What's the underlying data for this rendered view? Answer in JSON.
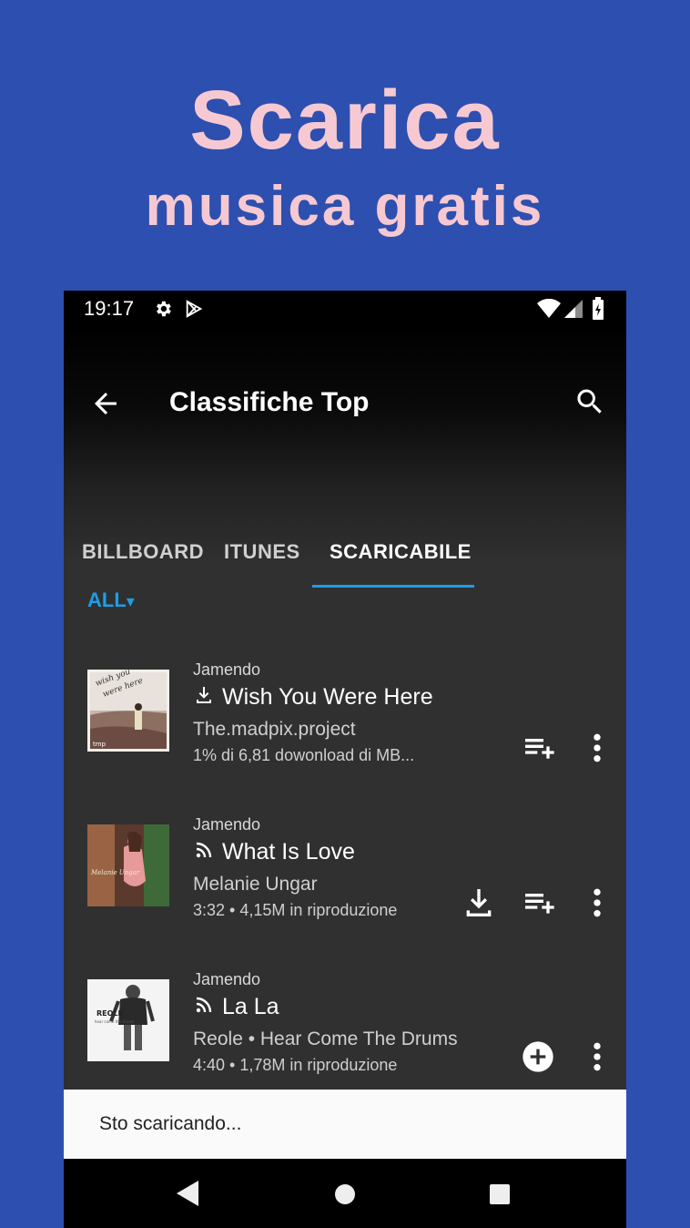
{
  "promo": {
    "title": "Scarica",
    "subtitle": "musica gratis"
  },
  "status_bar": {
    "time": "19:17",
    "icons": [
      "settings-icon",
      "play-store-icon",
      "wifi-icon",
      "cellular-signal-icon",
      "battery-charging-icon"
    ]
  },
  "app_bar": {
    "title": "Classifiche Top",
    "back_icon": "arrow-back-icon",
    "search_icon": "search-icon"
  },
  "tabs": [
    {
      "label": "BILLBOARD",
      "active": false
    },
    {
      "label": "ITUNES",
      "active": false
    },
    {
      "label": "SCARICABILE",
      "active": true
    }
  ],
  "filter": {
    "label": "ALL",
    "arrow": "▾"
  },
  "tracks": [
    {
      "source": "Jamendo",
      "title": "Wish You Were Here",
      "status_icon": "download-icon",
      "artist": "The.madpix.project",
      "meta": "1% di 6,81 dowonload di MB...",
      "actions": [
        "add-to-queue-icon",
        "more-vert-icon"
      ]
    },
    {
      "source": "Jamendo",
      "title": "What Is Love",
      "status_icon": "streaming-icon",
      "artist": "Melanie Ungar",
      "meta": "3:32 • 4,15M in riproduzione",
      "actions": [
        "download-icon",
        "add-to-queue-icon",
        "more-vert-icon"
      ]
    },
    {
      "source": "Jamendo",
      "title": "La La",
      "status_icon": "streaming-icon",
      "artist": "Reole • Hear Come The Drums",
      "meta": "4:40 • 1,78M in riproduzione",
      "actions": [
        "add-circle-icon",
        "more-vert-icon"
      ]
    }
  ],
  "snackbar": {
    "text": "Sto scaricando..."
  },
  "nav_bar": {
    "icons": [
      "nav-back-icon",
      "nav-home-icon",
      "nav-recents-icon"
    ]
  },
  "colors": {
    "background": "#2d4faf",
    "promo_text": "#f6c9d2",
    "accent": "#1e9ee6",
    "surface": "#303030"
  }
}
